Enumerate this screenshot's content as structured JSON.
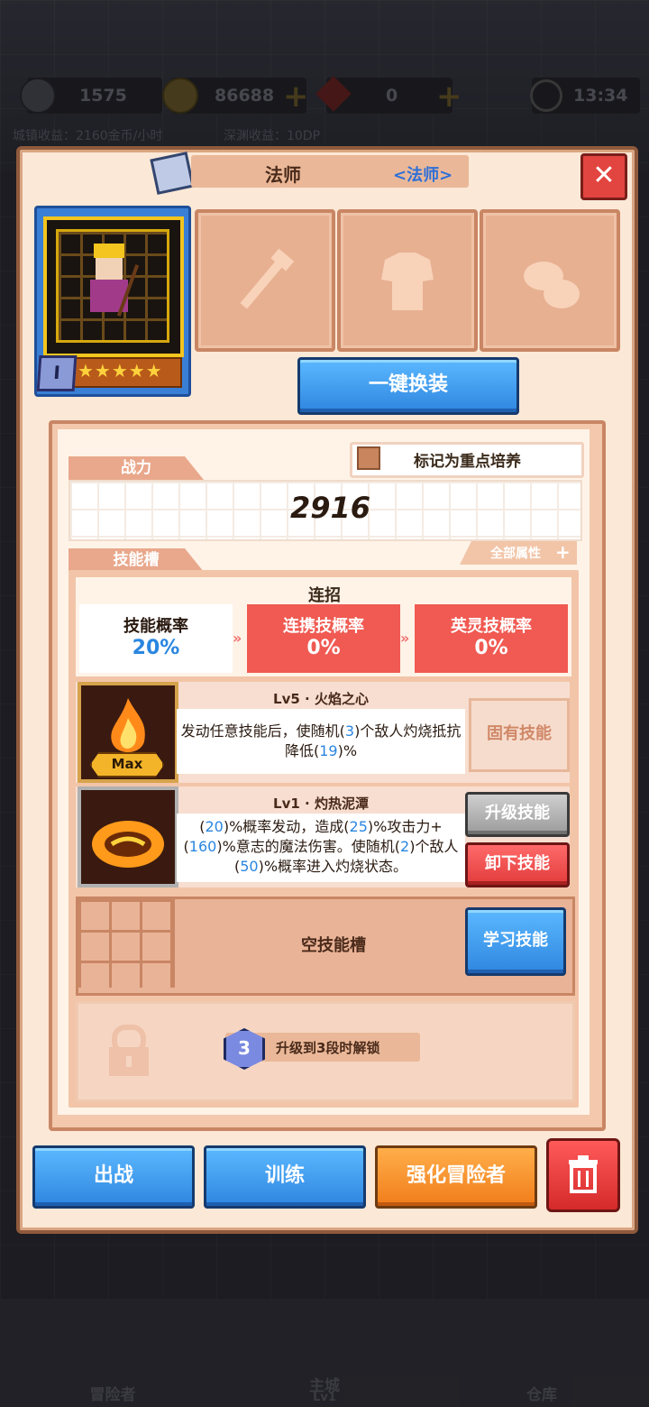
{
  "resources": {
    "stamina": "1575",
    "gold": "86688",
    "gems": "0",
    "time": "13:34",
    "gold_income": "城镇收益：2160金币/小时",
    "abyss_income": "深渊收益：10DP"
  },
  "panel": {
    "title": "法师",
    "class_tag": "<法师>",
    "close_icon": "✕",
    "rank": "I",
    "stars": "★★★★★",
    "quick_equip": "一键换装",
    "mark_label": "标记为重点培养",
    "power_tab": "战力",
    "power_value": "2916",
    "all_attributes": "全部属性",
    "skill_slots_tab": "技能槽"
  },
  "combo": {
    "title": "连招",
    "cells": [
      {
        "label": "技能概率",
        "value": "20%"
      },
      {
        "label": "连携技概率",
        "value": "0%"
      },
      {
        "label": "英灵技概率",
        "value": "0%"
      }
    ]
  },
  "skills": [
    {
      "name": "Lv5 · 火焰之心",
      "badge": "Max",
      "desc_parts": [
        "发动任意技能后，使随机(",
        "3",
        ")个敌人灼烧抵抗降低(",
        "19",
        ")%"
      ],
      "button": "固有技能"
    },
    {
      "name": "Lv1 · 灼热泥潭",
      "desc_parts": [
        "(",
        "20",
        ")%概率发动，造成(",
        "25",
        ")%攻击力+(",
        "160",
        ")%意志的魔法伤害。使随机(",
        "2",
        ")个敌人(",
        "50",
        ")%概率进入灼烧状态。"
      ],
      "upgrade_button": "升级技能",
      "remove_button": "卸下技能"
    }
  ],
  "empty_slot": {
    "label": "空技能槽",
    "button": "学习技能"
  },
  "locked_slot": {
    "badge": "3",
    "label": "升级到3段时解锁"
  },
  "actions": {
    "deploy": "出战",
    "train": "训练",
    "enhance": "强化冒险者",
    "trash_icon": "🗑"
  },
  "nav": {
    "adventurer": "冒险者",
    "main_city": "主城",
    "main_city_level": "Lv1",
    "warehouse": "仓库"
  }
}
